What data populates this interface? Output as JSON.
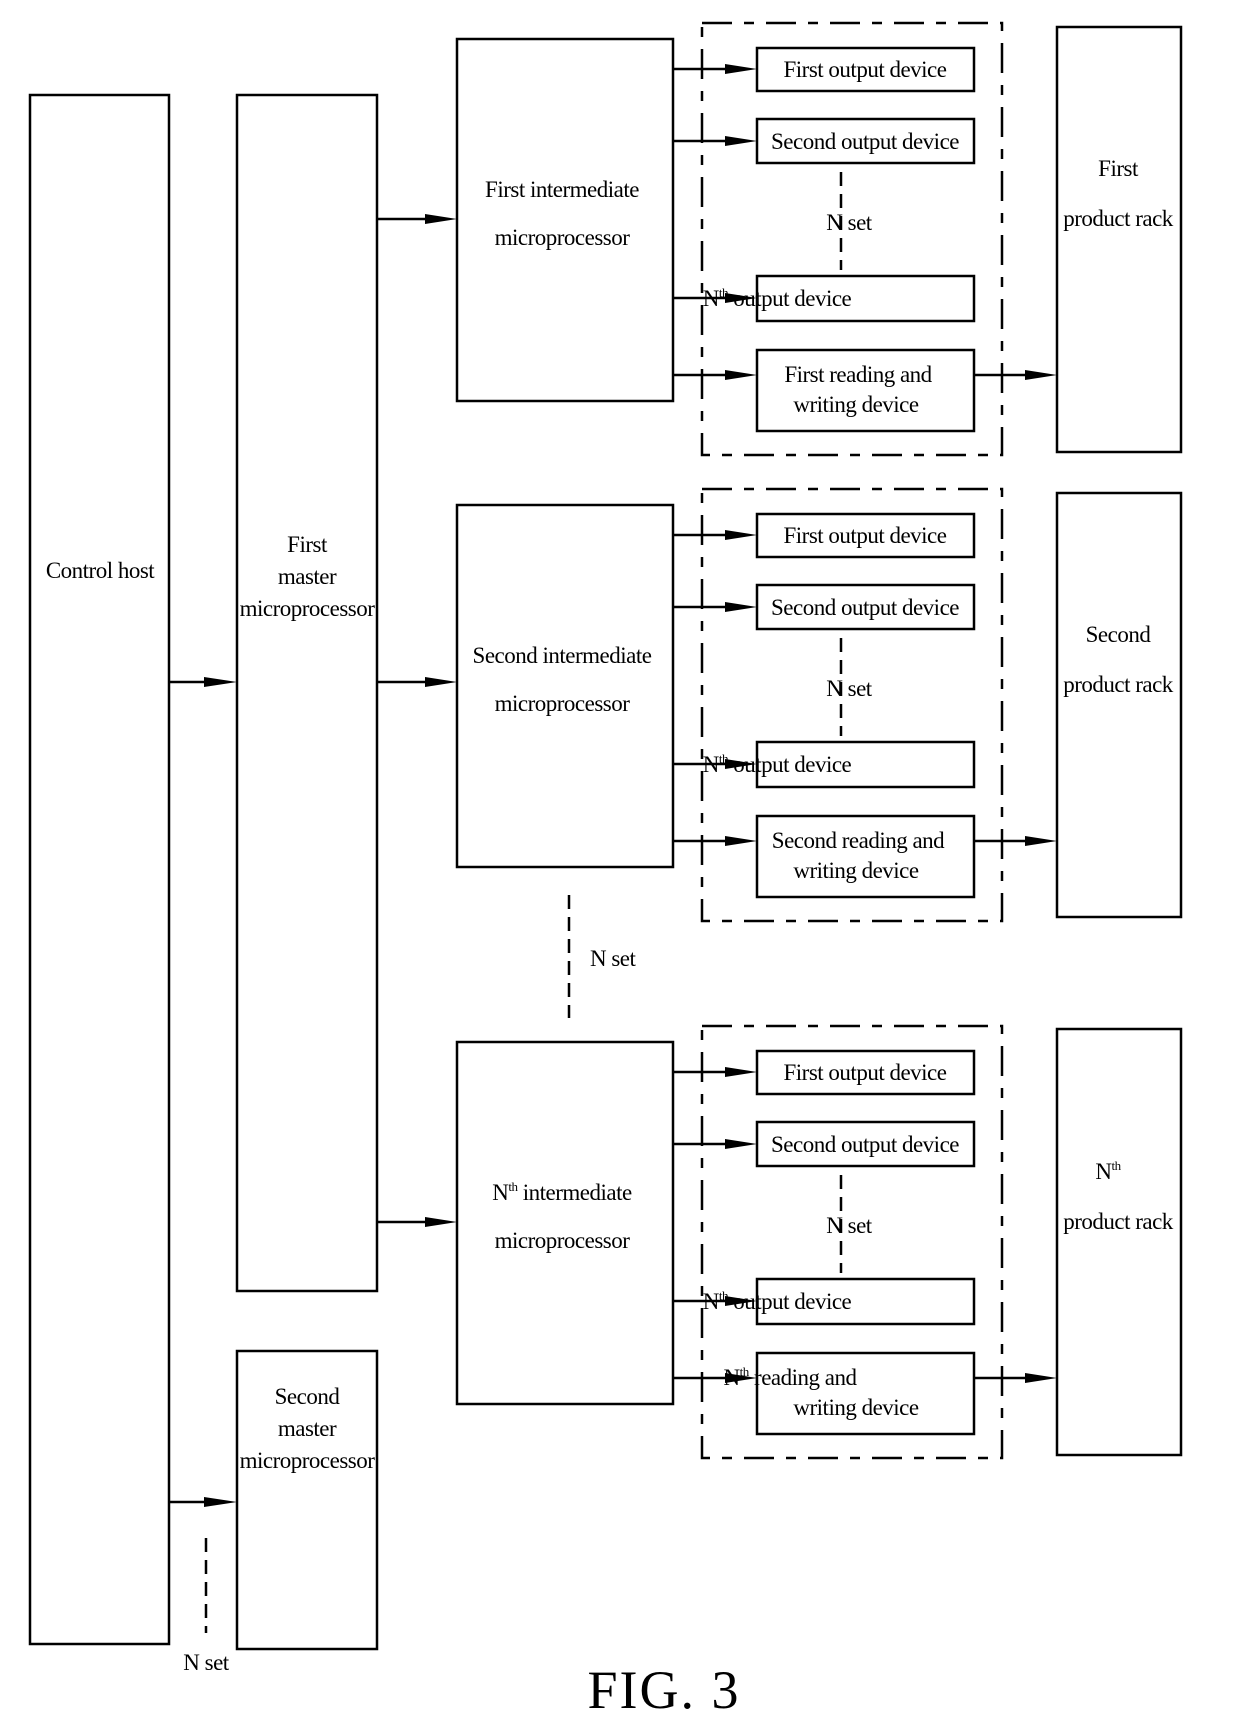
{
  "figure": {
    "caption": "FIG. 3"
  },
  "control_host": {
    "label": "Control host"
  },
  "master_microprocessors": [
    {
      "lines": [
        "First",
        "master",
        "microprocessor"
      ]
    },
    {
      "lines": [
        "Second",
        "master",
        "microprocessor"
      ]
    }
  ],
  "n_set_label": "N set",
  "nth_superscript": "th",
  "sections": [
    {
      "intermediate": {
        "lines": [
          {
            "prefix": "",
            "sup": "",
            "text": "First intermediate"
          },
          {
            "prefix": "",
            "sup": "",
            "text": "microprocessor"
          }
        ]
      },
      "outputs": [
        {
          "prefix": "",
          "sup": "",
          "text": "First output device"
        },
        {
          "prefix": "",
          "sup": "",
          "text": "Second output device"
        },
        {
          "prefix": "N",
          "sup": "th",
          "text": "output device"
        }
      ],
      "reader": {
        "line1_prefix": "",
        "line1_sup": "",
        "line1": "First reading and",
        "line2": "writing device"
      },
      "rack": {
        "line1_prefix": "",
        "line1_sup": "",
        "line1": "First",
        "line2": "product rack"
      }
    },
    {
      "intermediate": {
        "lines": [
          {
            "prefix": "",
            "sup": "",
            "text": "Second intermediate"
          },
          {
            "prefix": "",
            "sup": "",
            "text": "microprocessor"
          }
        ]
      },
      "outputs": [
        {
          "prefix": "",
          "sup": "",
          "text": "First output device"
        },
        {
          "prefix": "",
          "sup": "",
          "text": "Second output device"
        },
        {
          "prefix": "N",
          "sup": "th",
          "text": "output device"
        }
      ],
      "reader": {
        "line1_prefix": "",
        "line1_sup": "",
        "line1": "Second reading and",
        "line2": "writing device"
      },
      "rack": {
        "line1_prefix": "",
        "line1_sup": "",
        "line1": "Second",
        "line2": "product rack"
      }
    },
    {
      "intermediate": {
        "lines": [
          {
            "prefix": "N",
            "sup": "th",
            "text": "intermediate"
          },
          {
            "prefix": "",
            "sup": "",
            "text": "microprocessor"
          }
        ]
      },
      "outputs": [
        {
          "prefix": "",
          "sup": "",
          "text": "First output device"
        },
        {
          "prefix": "",
          "sup": "",
          "text": "Second output device"
        },
        {
          "prefix": "N",
          "sup": "th",
          "text": "output device"
        }
      ],
      "reader": {
        "line1_prefix": "N",
        "line1_sup": "th",
        "line1": "reading and",
        "line2": "writing device"
      },
      "rack": {
        "line1_prefix": "N",
        "line1_sup": "th",
        "line1": "",
        "line2": "product rack"
      }
    }
  ]
}
